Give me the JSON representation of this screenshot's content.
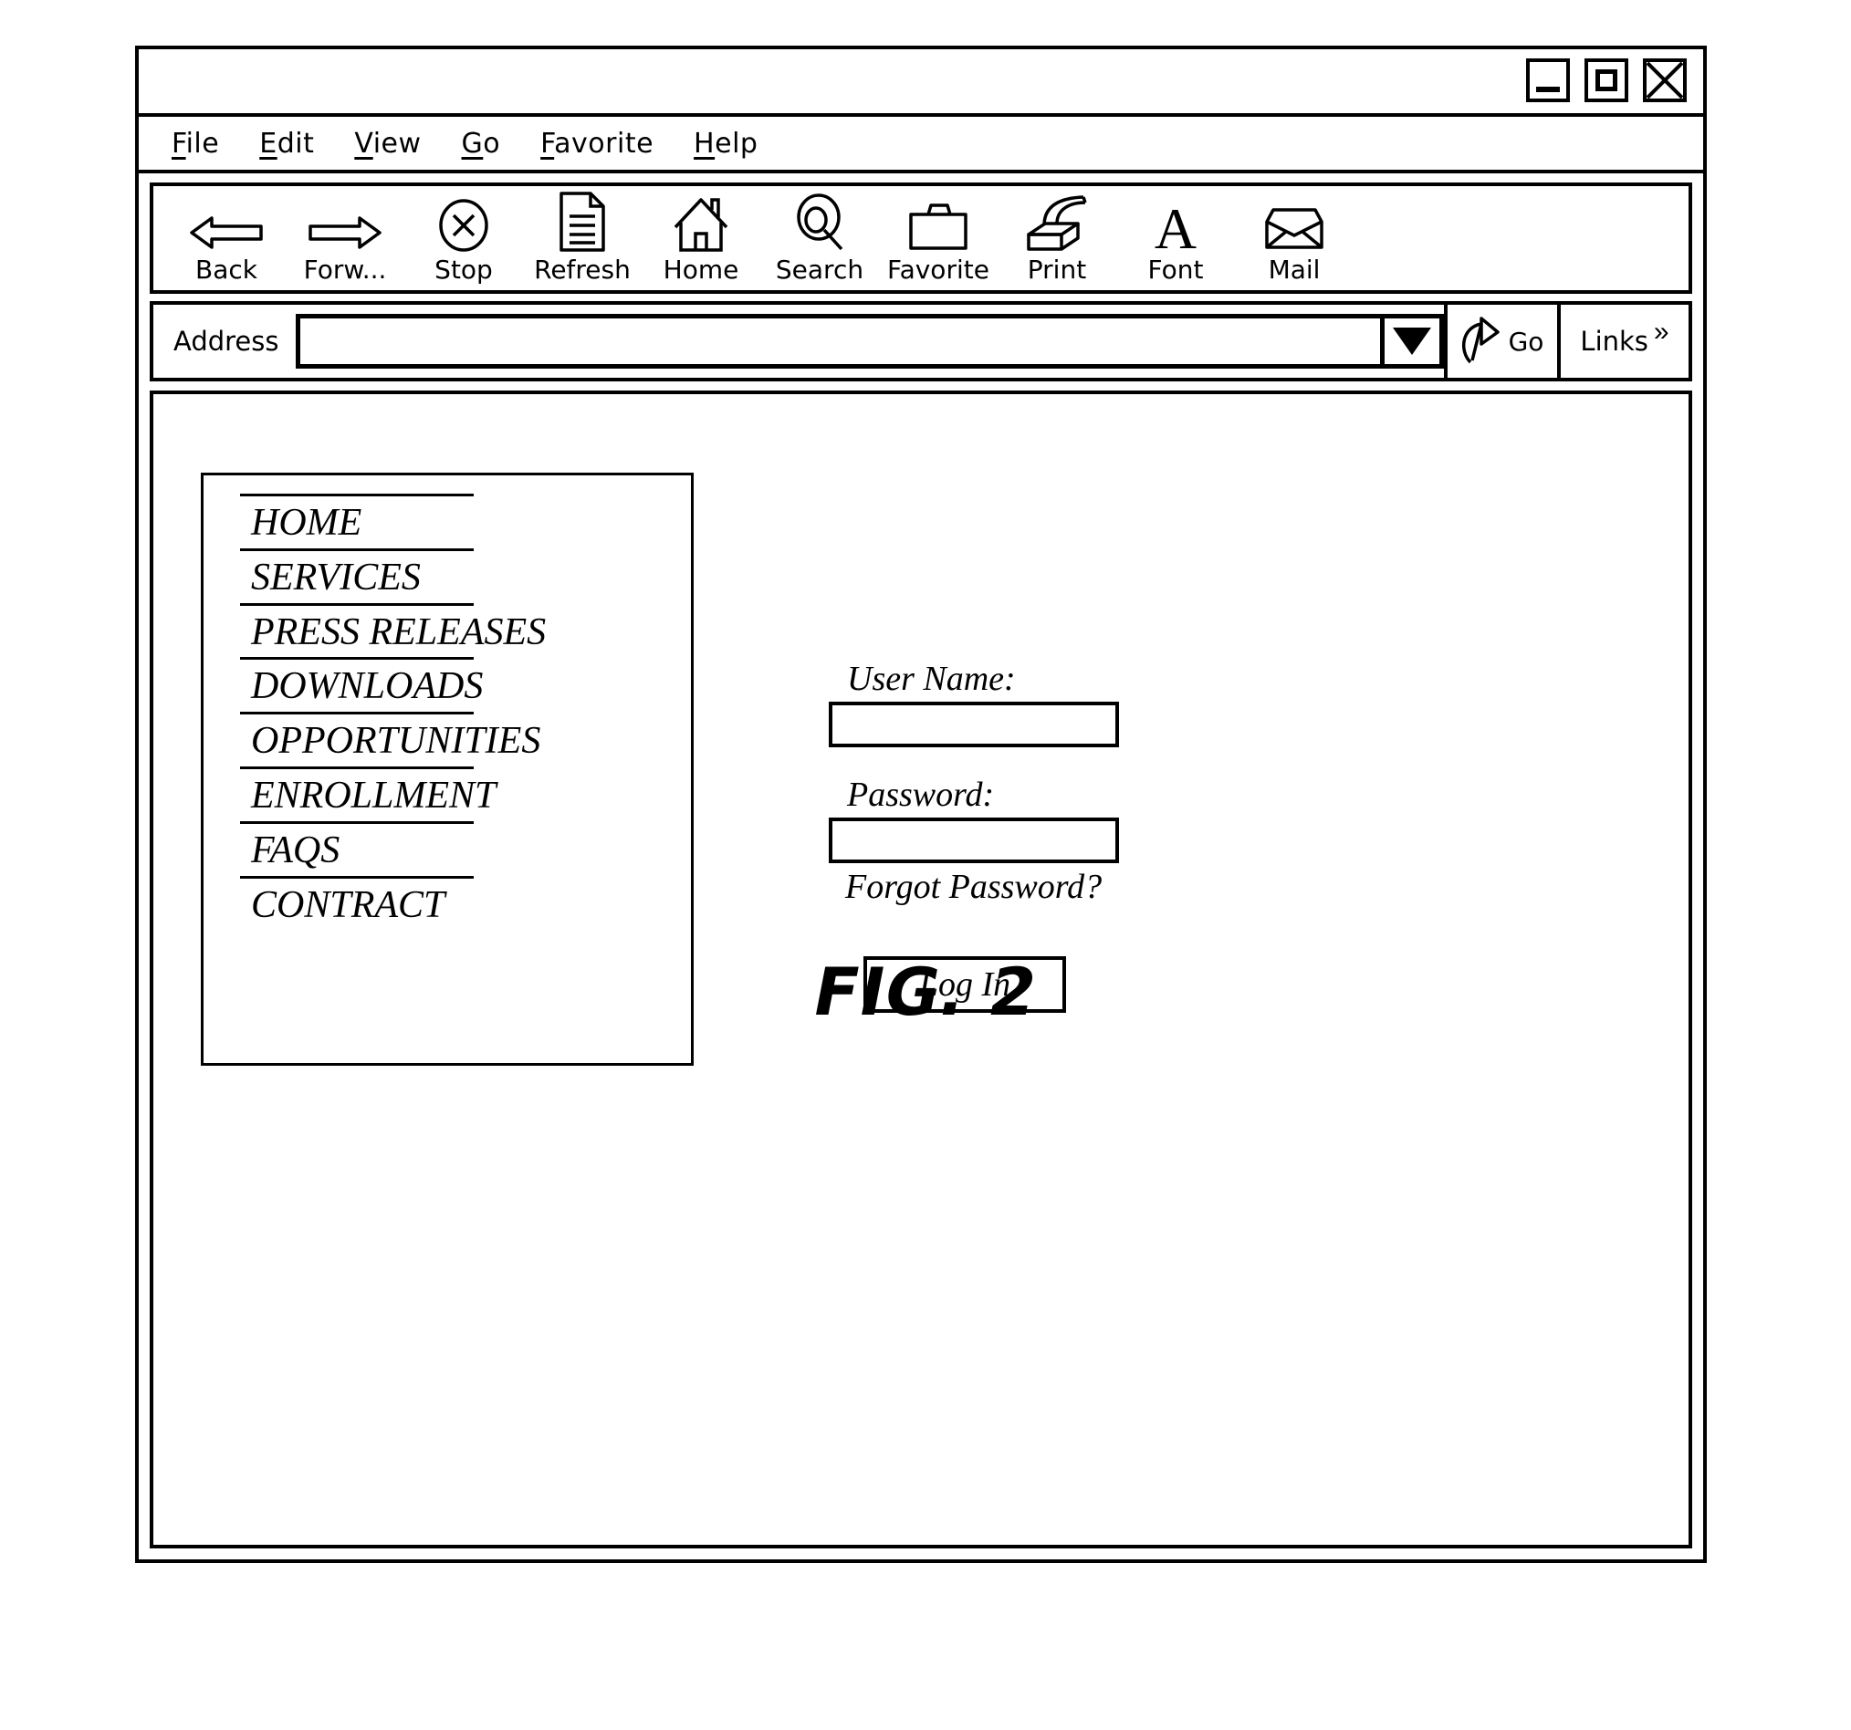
{
  "figure": {
    "caption": "FIG. 2"
  },
  "window": {
    "title": "",
    "controls": [
      {
        "name": "minimize",
        "label": "Minimize"
      },
      {
        "name": "maximize",
        "label": "Maximize"
      },
      {
        "name": "close",
        "label": "Close"
      }
    ]
  },
  "menu_bar": {
    "items": [
      {
        "label": "File",
        "accel": "F",
        "rest": "ile"
      },
      {
        "label": "Edit",
        "accel": "E",
        "rest": "dit"
      },
      {
        "label": "View",
        "accel": "V",
        "rest": "iew"
      },
      {
        "label": "Go",
        "accel": "G",
        "rest": "o"
      },
      {
        "label": "Favorite",
        "accel": "F",
        "rest": "avorite"
      },
      {
        "label": "Help",
        "accel": "H",
        "rest": "elp"
      }
    ]
  },
  "toolbar": {
    "buttons": [
      {
        "label": "Back",
        "icon": "arrow-left-icon"
      },
      {
        "label": "Forw...",
        "icon": "arrow-right-icon"
      },
      {
        "label": "Stop",
        "icon": "stop-circle-x-icon"
      },
      {
        "label": "Refresh",
        "icon": "document-icon"
      },
      {
        "label": "Home",
        "icon": "house-icon"
      },
      {
        "label": "Search",
        "icon": "magnifier-icon"
      },
      {
        "label": "Favorite",
        "icon": "folder-icon"
      },
      {
        "label": "Print",
        "icon": "printer-icon"
      },
      {
        "label": "Font",
        "icon": "letter-a-icon"
      },
      {
        "label": "Mail",
        "icon": "envelope-icon"
      }
    ]
  },
  "address_bar": {
    "label": "Address",
    "value": "",
    "placeholder": "",
    "dropdown_icon": "chevron-down-icon",
    "go": {
      "label": "Go",
      "icon": "go-arrow-icon"
    },
    "links": {
      "label": "Links",
      "chevrons": "»"
    }
  },
  "nav_menu": {
    "items": [
      {
        "label": "HOME"
      },
      {
        "label": "SERVICES"
      },
      {
        "label": "PRESS RELEASES"
      },
      {
        "label": "DOWNLOADS"
      },
      {
        "label": "OPPORTUNITIES"
      },
      {
        "label": "ENROLLMENT"
      },
      {
        "label": "FAQS"
      },
      {
        "label": "CONTRACT"
      }
    ]
  },
  "login_form": {
    "username_label": "User Name:",
    "username_value": "",
    "username_placeholder": "",
    "password_label": "Password:",
    "password_value": "",
    "password_placeholder": "",
    "forgot_password_label": "Forgot Password?",
    "submit_label": "Log In"
  },
  "colors": {
    "line": "#000000",
    "background": "#ffffff"
  }
}
